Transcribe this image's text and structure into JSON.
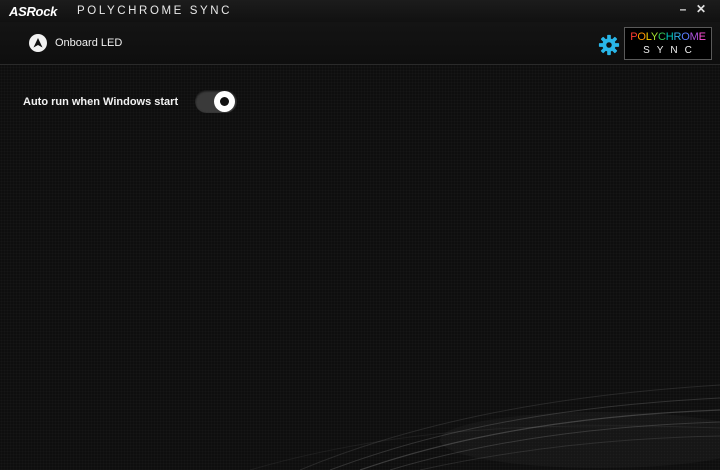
{
  "titlebar": {
    "brand": "ASRock",
    "title": "POLYCHROME SYNC",
    "minimize_label": "–",
    "close_label": "✕"
  },
  "nav": {
    "items": [
      {
        "label": "Onboard LED",
        "icon": "rocket-icon"
      }
    ]
  },
  "header": {
    "settings_icon": "gear-icon",
    "logo": {
      "top_letters": [
        "P",
        "O",
        "L",
        "Y",
        "C",
        "H",
        "R",
        "O",
        "M",
        "E"
      ],
      "top_colors": [
        "#ff3b30",
        "#ff9500",
        "#ffd400",
        "#a6e22e",
        "#34c759",
        "#00c7be",
        "#32ade6",
        "#5a7dff",
        "#af52de",
        "#ff4fd8"
      ],
      "bottom": "SYNC"
    }
  },
  "settings": {
    "auto_run_label": "Auto run when Windows start",
    "auto_run_enabled": true
  },
  "colors": {
    "accent": "#29b6e8",
    "background": "#0d0d0d"
  }
}
